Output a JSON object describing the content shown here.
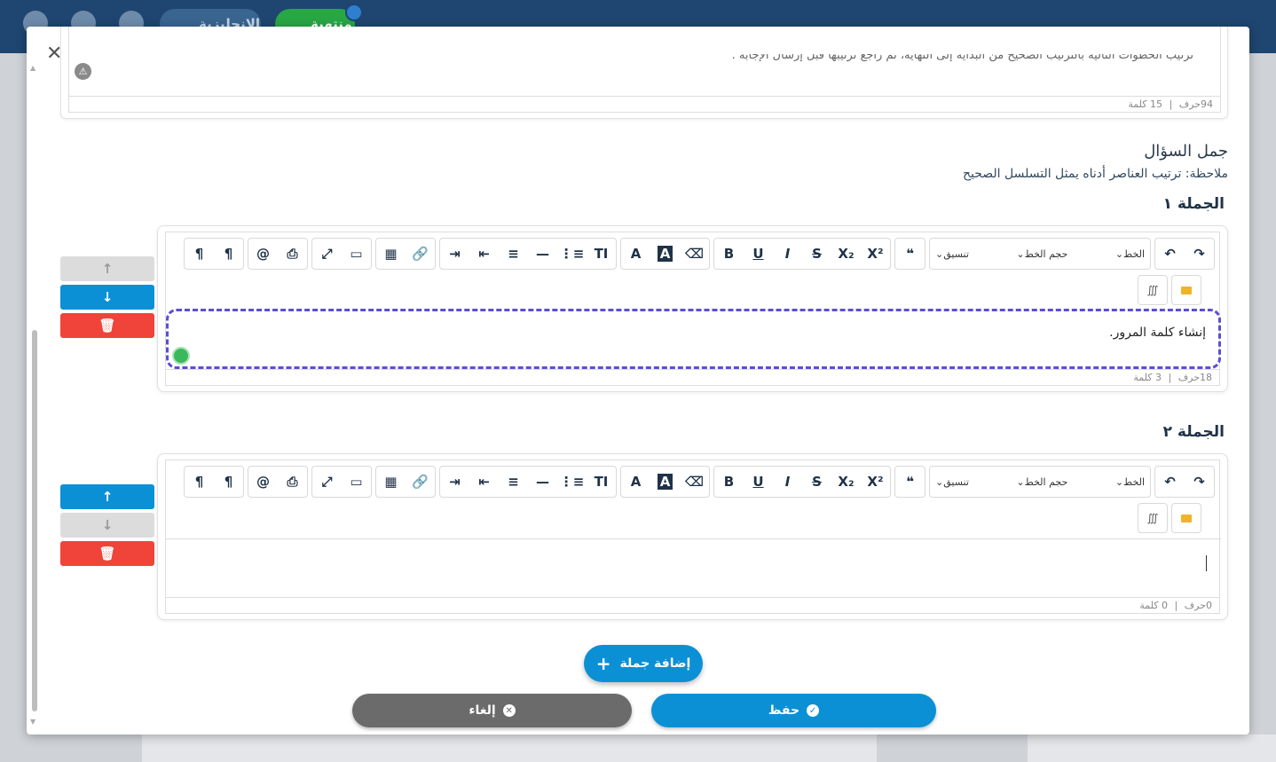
{
  "background": {
    "topbar_buttons": [
      "الإنجليزية",
      "منتهية"
    ]
  },
  "modal": {
    "close_icon": "close-icon",
    "prev_text": "ترتيب الخطوات التالية بالترتيب الصحيح من البداية إلى النهاية، ثم راجع ترتيبها قبل إرسال الإجابة .",
    "prev_counts": {
      "chars": "94حرف",
      "sep": "|",
      "words": "15 كلمة"
    },
    "section_title": "جمل السؤال",
    "section_note": "ملاحظة: ترتيب العناصر أدناه يمثل التسلسل الصحيح",
    "sentences": [
      {
        "label": "الجملة ١",
        "content": "إنشاء كلمة المرور.",
        "counts": {
          "chars": "18حرف",
          "sep": "|",
          "words": "3 كلمة"
        }
      },
      {
        "label": "الجملة ٢",
        "content": "",
        "counts": {
          "chars": "0حرف",
          "sep": "|",
          "words": "0 كلمة"
        }
      }
    ],
    "toolbar": {
      "groups": [
        [
          "¶",
          "¶"
        ],
        [
          "@",
          "⎙"
        ],
        [
          "⤢",
          "▭"
        ],
        [
          "▦",
          "🔗"
        ],
        [
          "⇥",
          "⇤",
          "≡",
          "—",
          "⋮≡",
          "TI"
        ],
        [
          "A",
          "A",
          "⌫"
        ],
        [
          "B",
          "U",
          "I",
          "S",
          "X₂",
          "X²"
        ],
        [
          "❝"
        ]
      ],
      "font_label": "الخط",
      "size_label": "حجم الخط",
      "format_label": "تنسيق",
      "undo": "↶",
      "redo": "↷",
      "special": "∭"
    },
    "add_button_label": "إضافة جملة",
    "add_button_icon": "+",
    "cancel_label": "إلغاء",
    "save_label": "حفظ",
    "arrow_up": "↑",
    "arrow_down": "↓",
    "trash": "🗑"
  }
}
